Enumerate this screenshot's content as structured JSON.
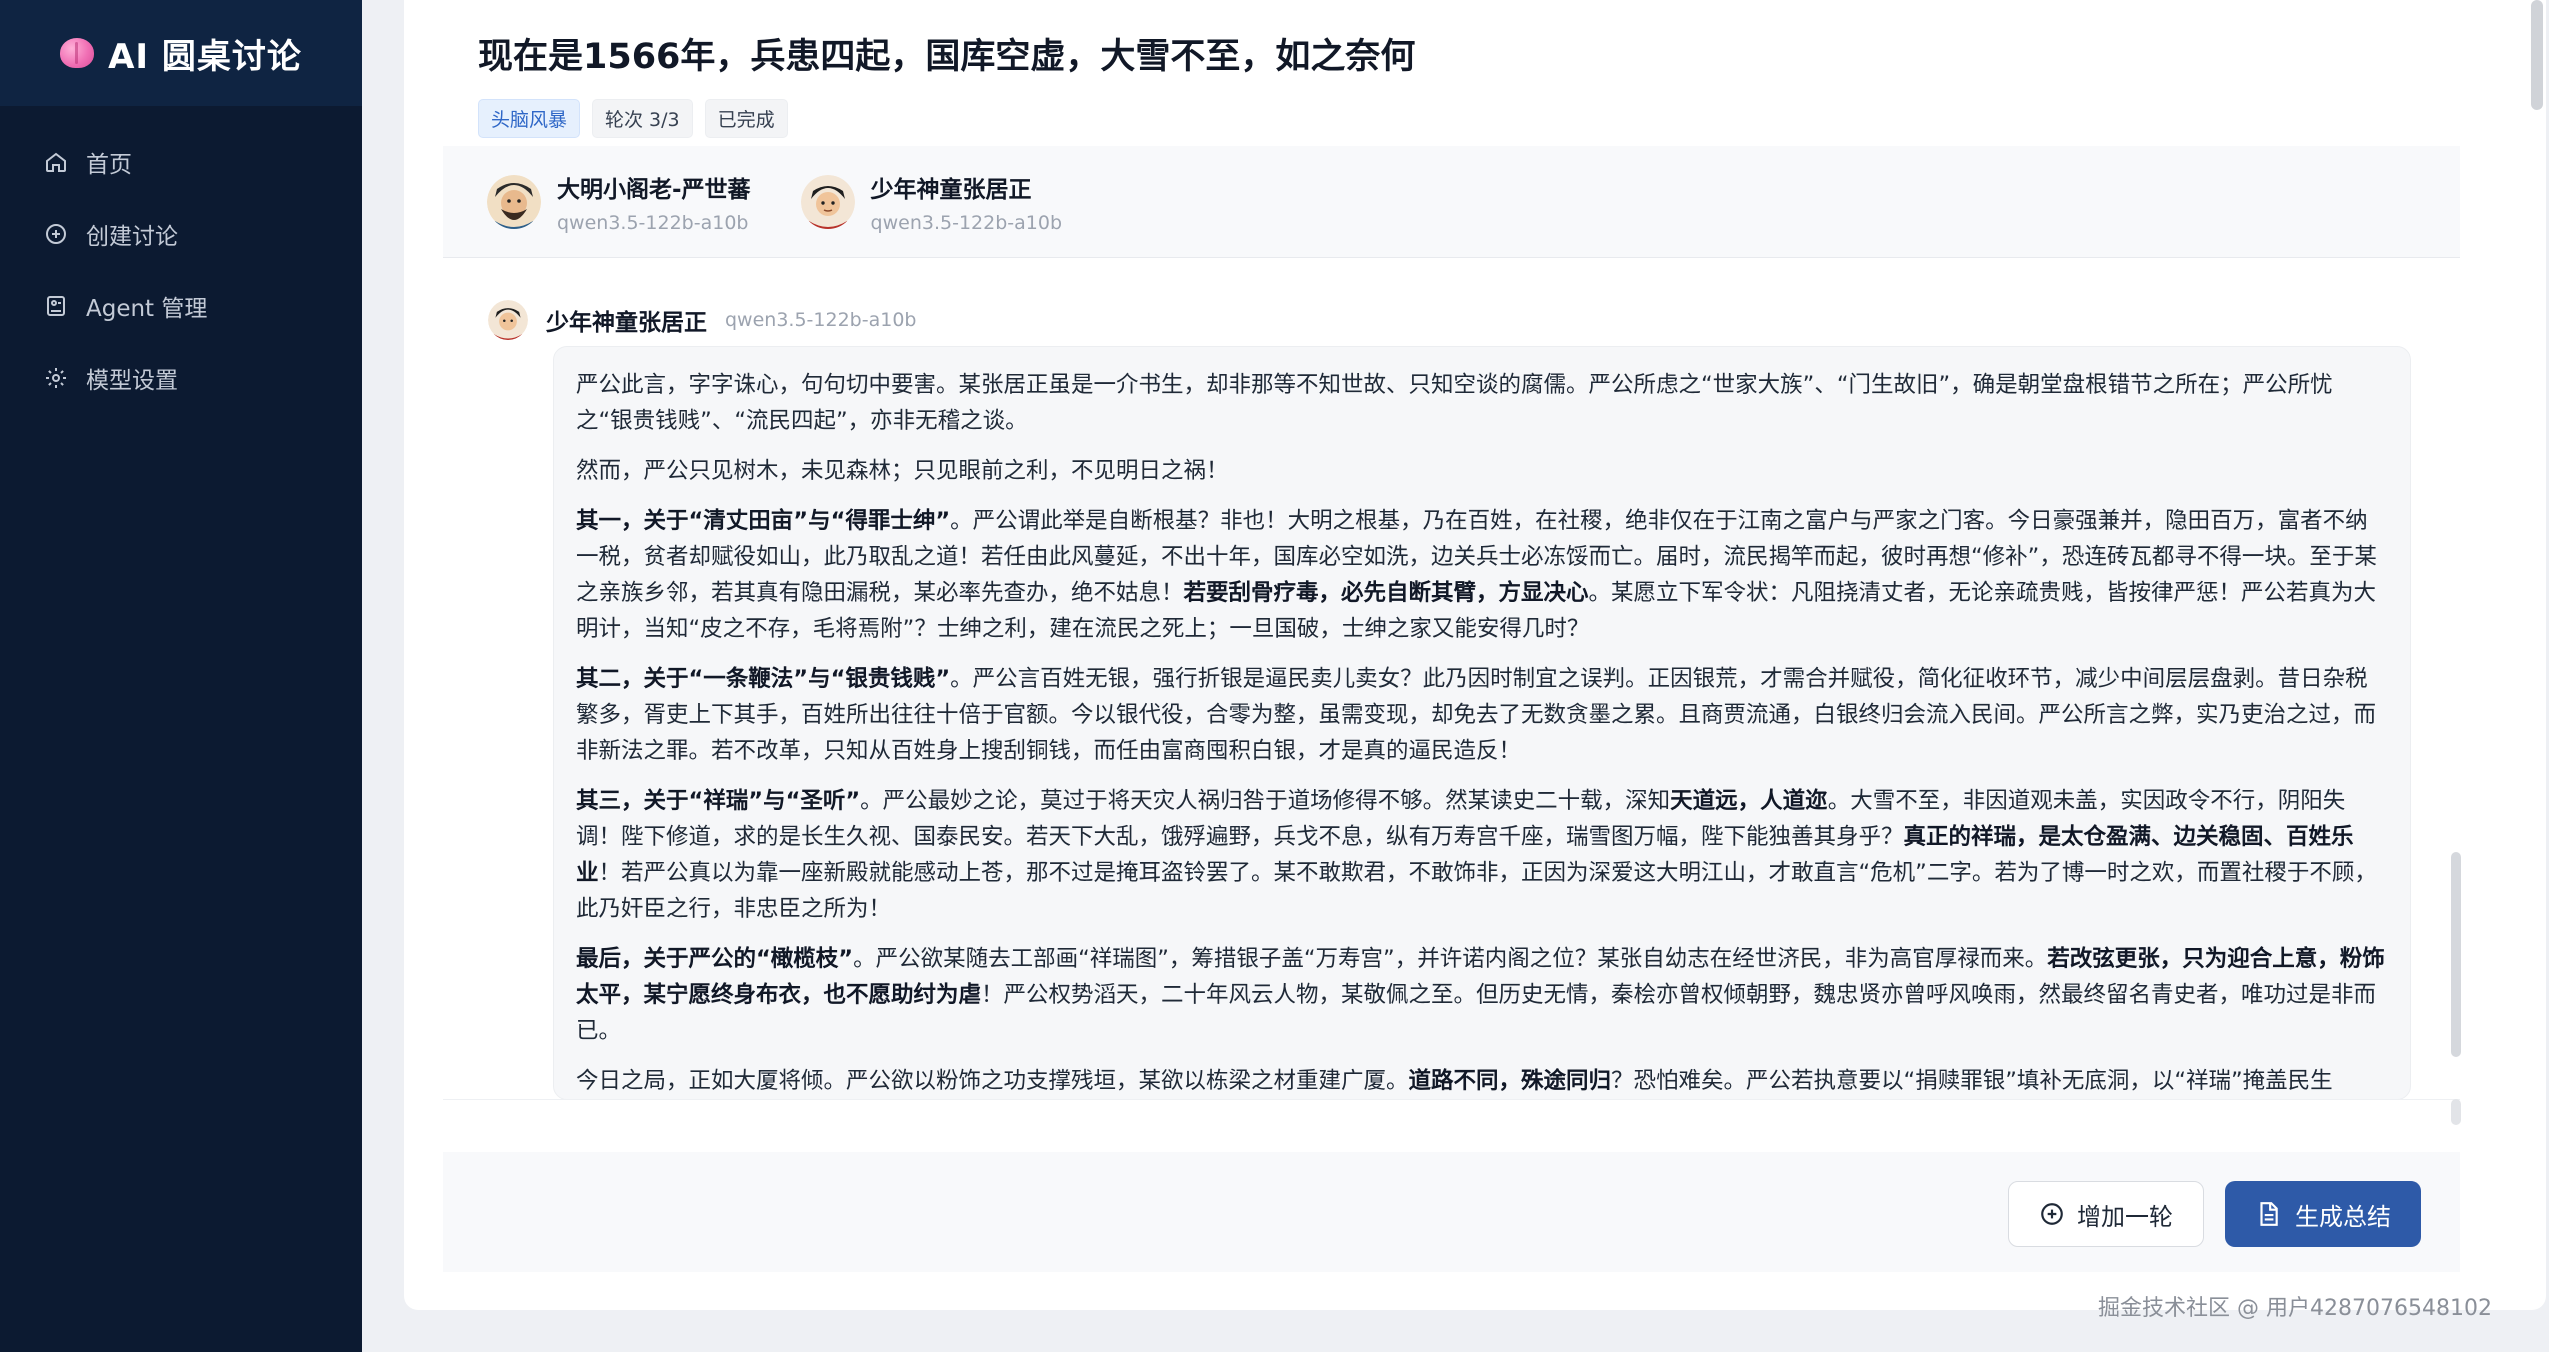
{
  "brand": {
    "title": "AI 圆桌讨论",
    "icon": "brain-icon"
  },
  "sidebar": {
    "items": [
      {
        "label": "首页",
        "icon": "home-icon"
      },
      {
        "label": "创建讨论",
        "icon": "plus-circle-icon"
      },
      {
        "label": "Agent 管理",
        "icon": "agent-icon"
      },
      {
        "label": "模型设置",
        "icon": "gear-icon"
      }
    ]
  },
  "header": {
    "title": "现在是1566年，兵患四起，国库空虚，大雪不至，如之奈何",
    "tags": {
      "mode": "头脑风暴",
      "round": "轮次 3/3",
      "status": "已完成"
    }
  },
  "participants": [
    {
      "name": "大明小阁老-严世蕃",
      "model": "qwen3.5-122b-a10b"
    },
    {
      "name": "少年神童张居正",
      "model": "qwen3.5-122b-a10b"
    }
  ],
  "message": {
    "author": "少年神童张居正",
    "model": "qwen3.5-122b-a10b",
    "p1": "严公此言，字字诛心，句句切中要害。某张居正虽是一介书生，却非那等不知世故、只知空谈的腐儒。严公所虑之“世家大族”、“门生故旧”，确是朝堂盘根错节之所在；严公所忧之“银贵钱贱”、“流民四起”，亦非无稽之谈。",
    "p2": "然而，严公只见树木，未见森林；只见眼前之利，不见明日之祸！",
    "p3_b1": "其一，关于“清丈田亩”与“得罪士绅”",
    "p3_t1": "。严公谓此举是自断根基？非也！大明之根基，乃在百姓，在社稷，绝非仅在于江南之富户与严家之门客。今日豪强兼并，隐田百万，富者不纳一税，贫者却赋役如山，此乃取乱之道！若任由此风蔓延，不出十年，国库必空如洗，边关兵士必冻馁而亡。届时，流民揭竿而起，彼时再想“修补”，恐连砖瓦都寻不得一块。至于某之亲族乡邻，若其真有隐田漏税，某必率先查办，绝不姑息！",
    "p3_b2": "若要刮骨疗毒，必先自断其臂，方显决心",
    "p3_t2": "。某愿立下军令状：凡阻挠清丈者，无论亲疏贵贱，皆按律严惩！严公若真为大明计，当知“皮之不存，毛将焉附”？士绅之利，建在流民之死上；一旦国破，士绅之家又能安得几时？",
    "p4_b1": "其二，关于“一条鞭法”与“银贵钱贱”",
    "p4_t1": "。严公言百姓无银，强行折银是逼民卖儿卖女？此乃因时制宜之误判。正因银荒，才需合并赋役，简化征收环节，减少中间层层盘剥。昔日杂税繁多，胥吏上下其手，百姓所出往往十倍于官额。今以银代役，合零为整，虽需变现，却免去了无数贪墨之累。且商贾流通，白银终归会流入民间。严公所言之弊，实乃吏治之过，而非新法之罪。若不改革，只知从百姓身上搜刮铜钱，而任由富商囤积白银，才是真的逼民造反！",
    "p5_b1": "其三，关于“祥瑞”与“圣听”",
    "p5_t1": "。严公最妙之论，莫过于将天灾人祸归咎于道场修得不够。然某读史二十载，深知",
    "p5_b2": "天道远，人道迩",
    "p5_t2": "。大雪不至，非因道观未盖，实因政令不行，阴阳失调！陛下修道，求的是长生久视、国泰民安。若天下大乱，饿殍遍野，兵戈不息，纵有万寿宫千座，瑞雪图万幅，陛下能独善其身乎？",
    "p5_b3": "真正的祥瑞，是太仓盈满、边关稳固、百姓乐业",
    "p5_t3": "！若严公真以为靠一座新殿就能感动上苍，那不过是掩耳盗铃罢了。某不敢欺君，不敢饰非，正因为深爱这大明江山，才敢直言“危机”二字。若为了博一时之欢，而置社稷于不顾，此乃奸臣之行，非忠臣之所为！",
    "p6_b1": "最后，关于严公的“橄榄枝”",
    "p6_t1": "。严公欲某随去工部画“祥瑞图”，筹措银子盖“万寿宫”，并许诺内阁之位？某张自幼志在经世济民，非为高官厚禄而来。",
    "p6_b2": "若改弦更张，只为迎合上意，粉饰太平，某宁愿终身布衣，也不愿助纣为虐",
    "p6_t2": "！严公权势滔天，二十年风云人物，某敬佩之至。但历史无情，秦桧亦曾权倾朝野，魏忠贤亦曾呼风唤雨，然最终留名青史者，唯功过是非而已。",
    "p7_t1": "今日之局，正如大厦将倾。严公欲以粉饰之功支撑残垣，某欲以栋梁之材重建广厦。",
    "p7_b1": "道路不同，殊途同归",
    "p7_t2": "？恐怕难矣。严公若执意要以“捐赎罪银”填补无底洞，以“祥瑞”掩盖民生"
  },
  "footer": {
    "add_round_label": "增加一轮",
    "summary_label": "生成总结"
  },
  "watermark": "掘金技术社区 @ 用户4287076548102"
}
